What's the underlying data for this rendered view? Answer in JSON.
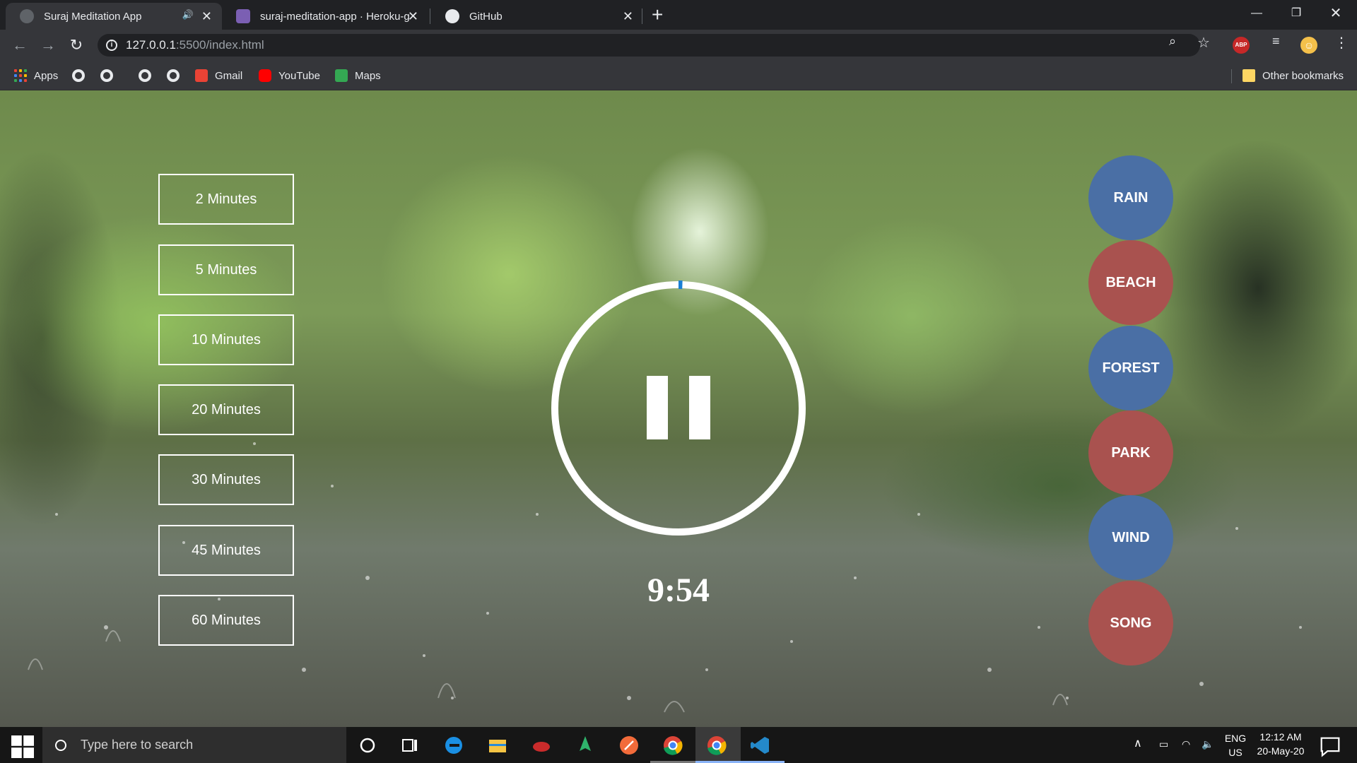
{
  "browser": {
    "tabs": [
      {
        "title": "Suraj Meditation App",
        "active": true
      },
      {
        "title": "suraj-meditation-app · Heroku-g",
        "active": false
      },
      {
        "title": "GitHub",
        "active": false
      }
    ],
    "url_host": "127.0.0.1",
    "url_path": ":5500/index.html",
    "bookmarks": {
      "apps": "Apps",
      "gmail": "Gmail",
      "youtube": "YouTube",
      "maps": "Maps",
      "other": "Other bookmarks"
    },
    "extension_abp": "ABP"
  },
  "app": {
    "durations": [
      "2 Minutes",
      "5 Minutes",
      "10 Minutes",
      "20 Minutes",
      "30 Minutes",
      "45 Minutes",
      "60 Minutes"
    ],
    "timer": "9:54",
    "progress": 0.01,
    "sounds": [
      {
        "label": "RAIN",
        "color": "#4a6fa5"
      },
      {
        "label": "BEACH",
        "color": "#a9524f"
      },
      {
        "label": "FOREST",
        "color": "#4a6fa5"
      },
      {
        "label": "PARK",
        "color": "#a9524f"
      },
      {
        "label": "WIND",
        "color": "#4a6fa5"
      },
      {
        "label": "SONG",
        "color": "#a9524f"
      }
    ],
    "accent_color": "#1a7fd4"
  },
  "taskbar": {
    "search_placeholder": "Type here to search",
    "lang_top": "ENG",
    "lang_bottom": "US",
    "time": "12:12 AM",
    "date": "20-May-20"
  }
}
